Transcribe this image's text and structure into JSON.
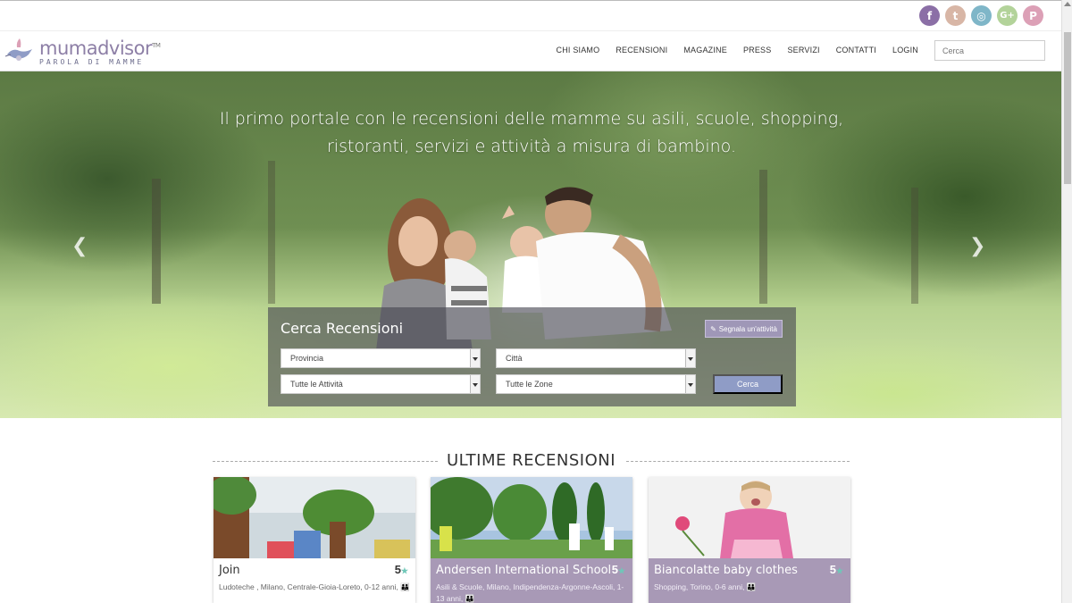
{
  "social": [
    {
      "label": "f",
      "icon": "facebook-icon",
      "color": "#8b6fa6"
    },
    {
      "label": "t",
      "icon": "twitter-icon",
      "color": "#d8b6a6"
    },
    {
      "label": "◎",
      "icon": "instagram-icon",
      "color": "#7fb6c8"
    },
    {
      "label": "G+",
      "icon": "google-plus-icon",
      "color": "#b3d39a"
    },
    {
      "label": "P",
      "icon": "pinterest-icon",
      "color": "#dca0b6"
    }
  ],
  "logo": {
    "name": "mumadvisor",
    "tm": "TM",
    "tagline": "PAROLA DI MAMME"
  },
  "nav": {
    "items": [
      "CHI SIAMO",
      "RECENSIONI",
      "MAGAZINE",
      "PRESS",
      "SERVIZI",
      "CONTATTI",
      "LOGIN"
    ],
    "search_placeholder": "Cerca"
  },
  "hero": {
    "title": "Il primo portale con le recensioni delle mamme su asili, scuole, shopping, ristoranti, servizi e attività a misura di bambino."
  },
  "search": {
    "title": "Cerca Recensioni",
    "report_label": "Segnala un'attività",
    "province": "Provincia",
    "city": "Città",
    "activities": "Tutte le Attività",
    "zones": "Tutte le Zone",
    "submit": "Cerca"
  },
  "section": {
    "title": "ULTIME RECENSIONI"
  },
  "cards": [
    {
      "name": "Join",
      "rating": "5",
      "meta": "Ludoteche , Milano, Centrale-Gioia-Loreto, 0-12 anni,"
    },
    {
      "name": "Andersen International School",
      "rating": "5",
      "meta": "Asili & Scuole, Milano, Indipendenza-Argonne-Ascoli, 1-13 anni,"
    },
    {
      "name": "Biancolatte baby clothes",
      "rating": "5",
      "meta": "Shopping, Torino, 0-6 anni,"
    }
  ],
  "colors": {
    "brand": "#8d7fa6",
    "card_info": "#a899b6",
    "star": "#6fc7b8",
    "button": "#8f9cc6"
  }
}
